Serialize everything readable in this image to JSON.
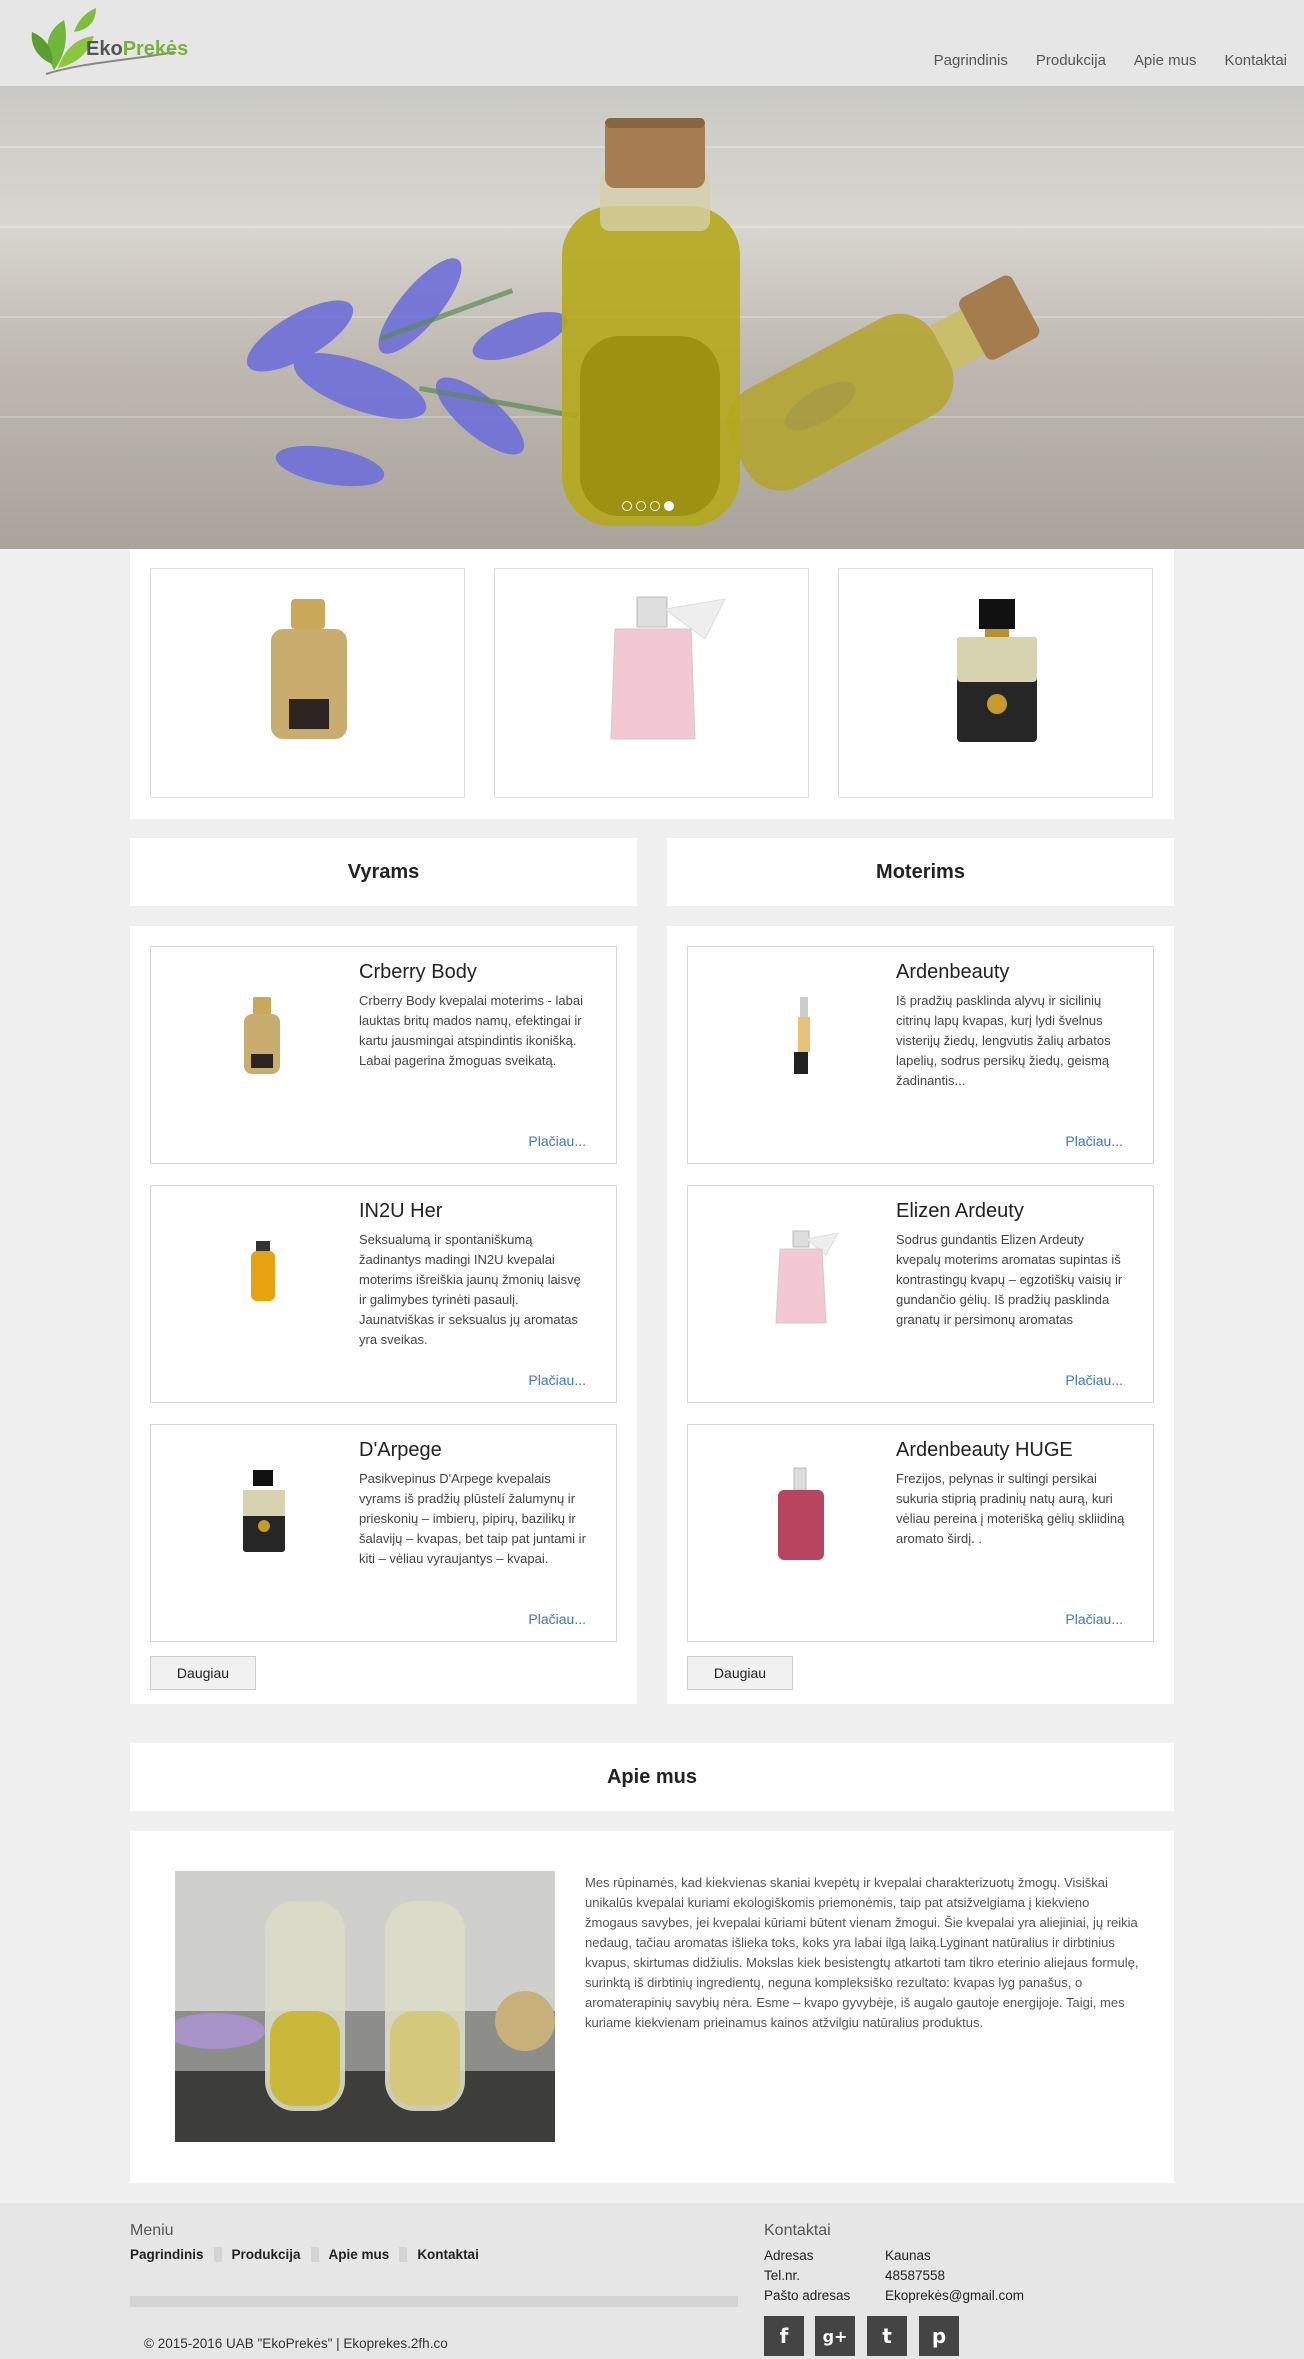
{
  "brand": {
    "name_part1": "Eko",
    "name_part2": "Prekės"
  },
  "nav": [
    {
      "label": "Pagrindinis"
    },
    {
      "label": "Produkcija"
    },
    {
      "label": "Apie mus"
    },
    {
      "label": "Kontaktai"
    }
  ],
  "carousel": {
    "slides": 4,
    "active_slide": 4
  },
  "sections": {
    "men": "Vyrams",
    "women": "Moterims",
    "about": "Apie mus"
  },
  "men_products": [
    {
      "title": "Crberry Body",
      "desc": "Crberry Body kvepalai moterims - labai lauktas britų mados namų, efektingai ir kartu jausmingai atspindintis ikonišką. Labai pagerina žmoguas sveikatą.",
      "more": "Plačiau..."
    },
    {
      "title": "IN2U Her",
      "desc": "Seksualumą ir spontaniškumą žadinantys madingi IN2U kvepalai moterims išreiškia jaunų žmonių laisvę ir galimybes tyrinėti pasaulį. Jaunatviškas ir seksualus jų aromatas yra sveikas.",
      "more": "Plačiau..."
    },
    {
      "title": "D'Arpege",
      "desc": "Pasikvepinus D'Arpege kvepalais vyrams iš pradžių plūstelí žalumynų ir prieskonių – imbierų, pipirų, bazilikų ir šalavijų – kvapas, bet taip pat juntami ir kiti – vėliau vyraujantys – kvapai.",
      "more": "Plačiau..."
    }
  ],
  "women_products": [
    {
      "title": "Ardenbeauty",
      "desc": "Iš pradžių pasklinda alyvų ir sicilinių citrinų lapų kvapas, kurį lydi švelnus visterijų žiedų, lengvutis žalių arbatos lapelių, sodrus persikų žiedų, geismą žadinantis...",
      "more": "Plačiau..."
    },
    {
      "title": "Elizen Ardeuty",
      "desc": "Sodrus gundantis Elizen Ardeuty kvepalų moterims aromatas supintas iš kontrastingų kvapų – egzotiškų vaisių ir gundančio gėlių. Iš pradžių pasklinda granatų ir persimonų aromatas",
      "more": "Plačiau..."
    },
    {
      "title": "Ardenbeauty HUGE",
      "desc": "Frezijos, pelynas ir sultingi persikai sukuria stiprią pradinių natų aurą, kuri vėliau pereina į moterišką gėlių skliidiną aromato širdį. .",
      "more": "Plačiau..."
    }
  ],
  "more_button": "Daugiau",
  "about_text": "Mes rūpinamės, kad kiekvienas skaniai kvepėtų ir kvepalai charakterizuotų žmogų. Visiškai unikalūs kvepalai kuriami ekologiškomis priemonėmis, taip pat atsižvelgiama į kiekvieno žmogaus savybes, jei kvepalai kūriami būtent vienam žmogui. Šie kvepalai yra aliejiniai, jų reikia nedaug, tačiau aromatas išlieka toks, koks yra labai ilgą laiką.Lyginant natūralius ir dirbtinius kvapus, skirtumas didžiulis. Mokslas kiek besistengtų atkartoti tam tikro eterinio aliejaus formulę, surinktą iš dirbtinių ingredientų, neguna kompleksiško rezultato: kvapas lyg panašus, o aromaterapinių savybių nėra. Esme – kvapo gyvybėje, iš augalo gautoje energijoje. Taigi, mes kuriame kiekvienam prieinamus kainos atžvilgiu natūralius produktus.",
  "footer": {
    "menu_title": "Meniu",
    "menu": [
      "Pagrindinis",
      "Produkcija",
      "Apie mus",
      "Kontaktai"
    ],
    "copyright": "© 2015-2016 UAB \"EkoPrekės\" | Ekoprekes.2fh.co",
    "contacts_title": "Kontaktai",
    "contacts": [
      {
        "label": "Adresas",
        "value": "Kaunas"
      },
      {
        "label": "Tel.nr.",
        "value": "48587558"
      },
      {
        "label": "Pašto adresas",
        "value": "Ekoprekės@gmail.com"
      }
    ],
    "social": [
      {
        "icon": "facebook-icon",
        "glyph": "f"
      },
      {
        "icon": "google-plus-icon",
        "glyph": "g+"
      },
      {
        "icon": "twitter-icon",
        "glyph": "t"
      },
      {
        "icon": "pinterest-icon",
        "glyph": "p"
      }
    ]
  }
}
